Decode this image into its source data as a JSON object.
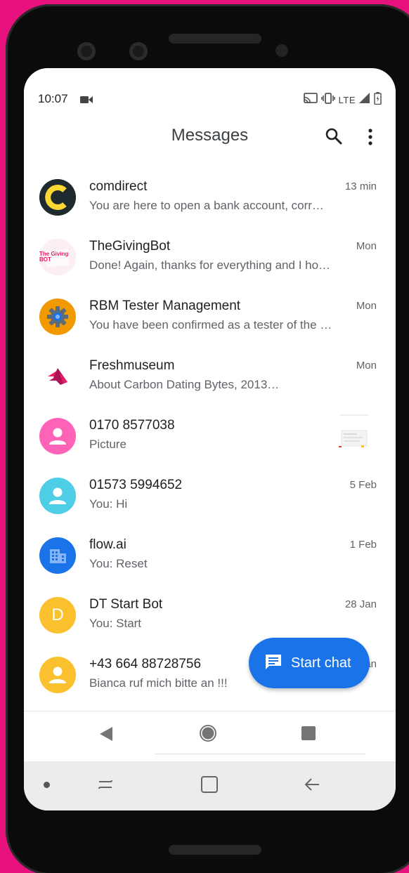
{
  "status_bar": {
    "time": "10:07",
    "network": "LTE"
  },
  "app_bar": {
    "title": "Messages"
  },
  "conversations": [
    {
      "name": "comdirect",
      "snippet": "You are here to open a bank account, corr…",
      "timestamp": "13 min",
      "avatar": "comdirect-logo"
    },
    {
      "name": "TheGivingBot",
      "snippet": "Done! Again, thanks for everything and I ho…",
      "timestamp": "Mon",
      "avatar": "thegivingbot-logo",
      "avatar_text": "The Giving BOT"
    },
    {
      "name": "RBM Tester Management",
      "snippet": "You have been confirmed as a tester of the …",
      "timestamp": "Mon",
      "avatar": "gear-logo"
    },
    {
      "name": "Freshmuseum",
      "snippet": "About Carbon Dating Bytes, 2013…",
      "timestamp": "Mon",
      "avatar": "freshmuseum-logo"
    },
    {
      "name": "0170 8577038",
      "snippet": "Picture",
      "timestamp": "",
      "avatar": "person-icon"
    },
    {
      "name": "01573 5994652",
      "snippet": "You: Hi",
      "timestamp": "5 Feb",
      "avatar": "person-icon"
    },
    {
      "name": "flow.ai",
      "snippet": "You: Reset",
      "timestamp": "1 Feb",
      "avatar": "building-icon"
    },
    {
      "name": "DT Start Bot",
      "snippet": "You: Start",
      "timestamp": "28 Jan",
      "avatar": "letter",
      "avatar_letter": "D"
    },
    {
      "name": "+43 664 88728756",
      "snippet": "Bianca ruf mich bitte an !!!",
      "timestamp": "Jan",
      "avatar": "person-icon"
    }
  ],
  "fab": {
    "label": "Start chat"
  },
  "colors": {
    "background": "#e8127f",
    "fab": "#1a73e8",
    "comdirect": "#fdd835",
    "gear_avatar": "#f29900",
    "pink_avatar": "#ff63b8",
    "cyan_avatar": "#4ecde6",
    "blue_avatar": "#1a73e8",
    "yellow_avatar": "#fbc02d"
  }
}
